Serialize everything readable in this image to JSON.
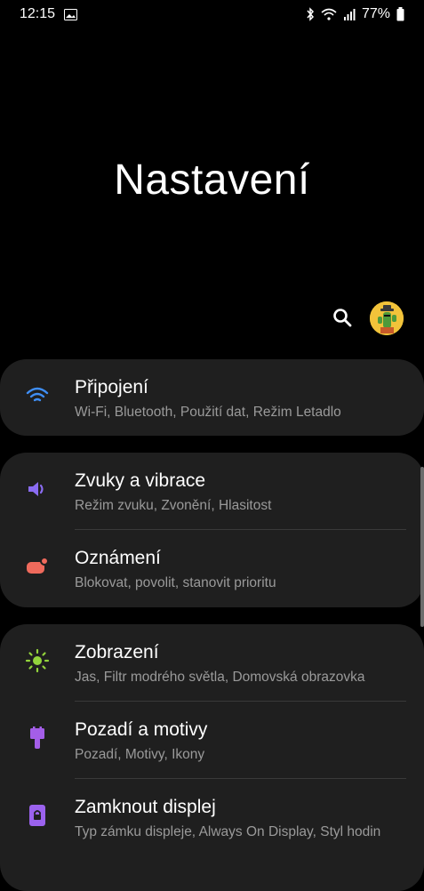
{
  "status_bar": {
    "time": "12:15",
    "battery": "77%",
    "icons": [
      "image-icon",
      "bluetooth-icon",
      "wifi-icon",
      "signal-icon",
      "battery-icon"
    ]
  },
  "header": {
    "title": "Nastavení"
  },
  "toolbar": {
    "search_icon": "search-icon",
    "avatar_icon": "cactus-avatar"
  },
  "groups": [
    {
      "items": [
        {
          "title": "Připojení",
          "subtitle": "Wi-Fi, Bluetooth, Použití dat, Režim Letadlo",
          "icon": "wifi-icon",
          "color": "#3f8ef5"
        }
      ]
    },
    {
      "items": [
        {
          "title": "Zvuky a vibrace",
          "subtitle": "Režim zvuku, Zvonění, Hlasitost",
          "icon": "volume-icon",
          "color": "#8a6cf1"
        },
        {
          "title": "Oznámení",
          "subtitle": "Blokovat, povolit, stanovit prioritu",
          "icon": "notification-icon",
          "color": "#ef6a5c"
        }
      ]
    },
    {
      "items": [
        {
          "title": "Zobrazení",
          "subtitle": "Jas, Filtr modrého světla, Domovská obrazovka",
          "icon": "brightness-icon",
          "color": "#93d43c"
        },
        {
          "title": "Pozadí a motivy",
          "subtitle": "Pozadí, Motivy, Ikony",
          "icon": "paintbrush-icon",
          "color": "#a45ee8"
        },
        {
          "title": "Zamknout displej",
          "subtitle": "Typ zámku displeje, Always On Display, Styl hodin",
          "icon": "lock-icon",
          "color": "#9b62ee"
        }
      ]
    }
  ]
}
